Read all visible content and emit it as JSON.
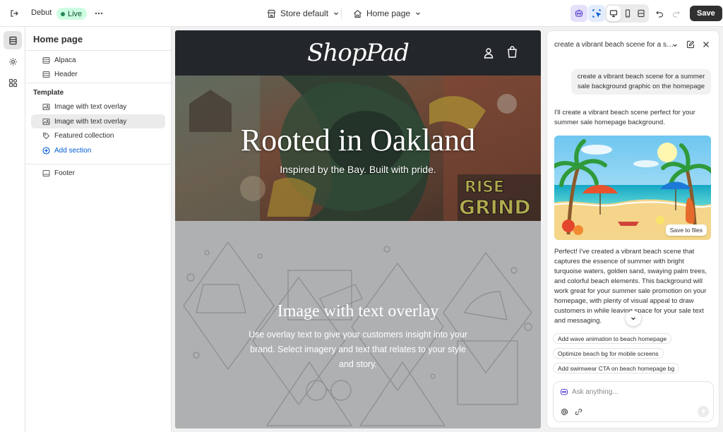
{
  "topbar": {
    "theme_name": "Debut",
    "status": "Live",
    "store_selector": "Store default",
    "page_selector": "Home page",
    "save_label": "Save"
  },
  "sidebar": {
    "title": "Home page",
    "header_items": [
      {
        "label": "Alpaca",
        "icon": "layout-icon"
      },
      {
        "label": "Header",
        "icon": "layout-icon"
      }
    ],
    "template_heading": "Template",
    "template_items": [
      {
        "label": "Image with text overlay",
        "icon": "image-icon"
      },
      {
        "label": "Image with text overlay",
        "icon": "image-icon",
        "selected": true
      },
      {
        "label": "Featured collection",
        "icon": "tag-icon"
      }
    ],
    "add_section": "Add section",
    "footer_item": {
      "label": "Footer",
      "icon": "layout-icon"
    }
  },
  "preview": {
    "logo": "ShopPad",
    "hero": {
      "title": "Rooted in Oakland",
      "subtitle": "Inspired by the Bay. Built with pride.",
      "mural_text_1": "RISE",
      "mural_text_2": "GRIND"
    },
    "overlay": {
      "title": "Image with text overlay",
      "body": "Use overlay text to give your customers insight into your brand. Select imagery and text that relates to your style and story."
    }
  },
  "assistant": {
    "conversation_title": "create a vibrant beach scene for a summer sale background graphic on the homepage",
    "user_prompt": "create a vibrant beach scene for a summer sale background graphic on the homepage",
    "reply_intro": "I'll create a vibrant beach scene perfect for your summer sale homepage background.",
    "save_to_files": "Save to files",
    "reply_body": "Perfect! I've created a vibrant beach scene that captures the essence of summer with bright turquoise waters, golden sand, swaying palm trees, and colorful beach elements. This background will work great for your summer sale promotion on your homepage, with plenty of visual appeal to draw customers in while leaving space for your sale text and messaging.",
    "suggestions": [
      "Add wave animation to beach homepage",
      "Optimize beach bg for mobile screens",
      "Add swimwear CTA on beach homepage bg"
    ],
    "input_placeholder": "Ask anything..."
  },
  "colors": {
    "accent": "#005bd3",
    "live_bg": "#cdfee1",
    "save_bg": "#303030",
    "shop_header": "#23272b"
  }
}
